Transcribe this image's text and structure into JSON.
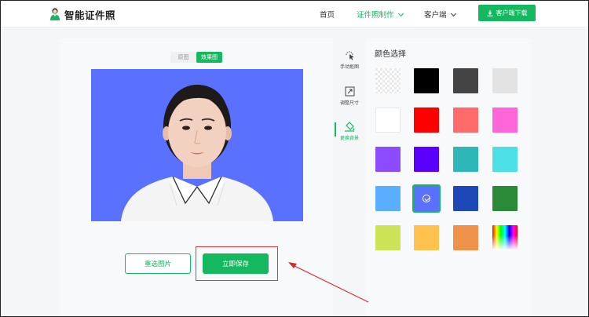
{
  "header": {
    "brand": "智能证件照",
    "nav": [
      {
        "label": "首页",
        "active": false,
        "dropdown": false
      },
      {
        "label": "证件照制作",
        "active": true,
        "dropdown": true
      },
      {
        "label": "客户端",
        "active": false,
        "dropdown": true
      }
    ],
    "download_label": "客户端下载",
    "download_icon": "download-icon"
  },
  "preview": {
    "tabs": [
      {
        "label": "原图",
        "active": false
      },
      {
        "label": "效果图",
        "active": true
      }
    ],
    "background_color": "#5a70fe"
  },
  "tools": [
    {
      "label": "手动抠图",
      "icon": "cursor-cutout-icon",
      "active": false
    },
    {
      "label": "调整尺寸",
      "icon": "resize-icon",
      "active": false
    },
    {
      "label": "更换背景",
      "icon": "paint-bucket-icon",
      "active": true
    }
  ],
  "actions": {
    "reselect_label": "重选图片",
    "save_label": "立即保存"
  },
  "color_panel": {
    "title": "颜色选择",
    "selected": "#5a70fe",
    "swatches": [
      "transparent",
      "#000000",
      "#444444",
      "#e3e3e3",
      "#ffffff",
      "#ff0000",
      "#ff6b6b",
      "#ff66d9",
      "#8c4bff",
      "#5b00ff",
      "#2eb7b9",
      "#4ddfe6",
      "#5aaeff",
      "#5a70fe",
      "#1c48b8",
      "#2b8a38",
      "#cce356",
      "#ffc34d",
      "#f0914a",
      "gradient"
    ]
  },
  "accent_color": "#14b85e"
}
